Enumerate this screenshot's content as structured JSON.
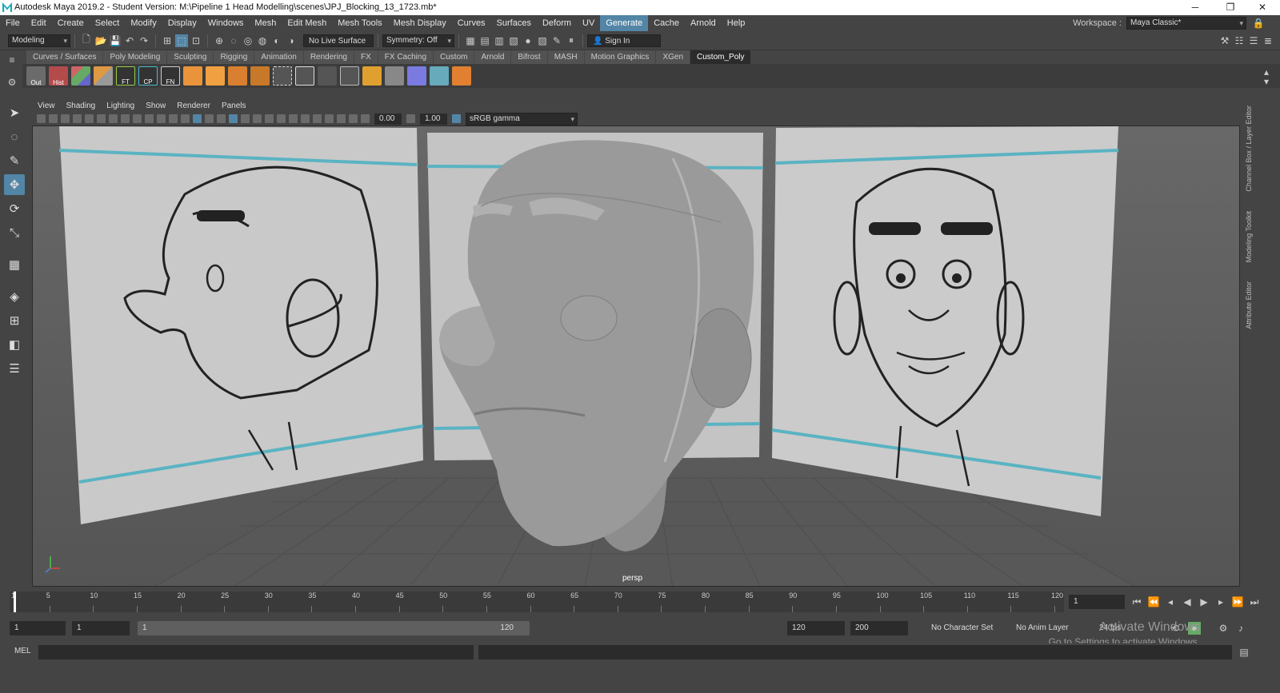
{
  "titlebar": {
    "title": "Autodesk Maya 2019.2 - Student Version: M:\\Pipeline 1 Head Modelling\\scenes\\JPJ_Blocking_13_1723.mb*",
    "minimize": "─",
    "restore": "❐",
    "close": "✕"
  },
  "menubar": {
    "items": [
      "File",
      "Edit",
      "Create",
      "Select",
      "Modify",
      "Display",
      "Windows",
      "Mesh",
      "Edit Mesh",
      "Mesh Tools",
      "Mesh Display",
      "Curves",
      "Surfaces",
      "Deform",
      "UV",
      "Generate",
      "Cache",
      "Arnold",
      "Help"
    ],
    "highlighted": "Generate",
    "workspace_label": "Workspace :",
    "workspace_value": "Maya Classic*"
  },
  "statusline": {
    "mode": "Modeling",
    "live_surface": "No Live Surface",
    "symmetry": "Symmetry: Off",
    "sign_in": "Sign In"
  },
  "shelf": {
    "tabs": [
      "Curves / Surfaces",
      "Poly Modeling",
      "Sculpting",
      "Rigging",
      "Animation",
      "Rendering",
      "FX",
      "FX Caching",
      "Custom",
      "Arnold",
      "Bifrost",
      "MASH",
      "Motion Graphics",
      "XGen",
      "Custom_Poly"
    ],
    "active_tab": "Custom_Poly",
    "labels": [
      "Out",
      "Hist",
      "",
      "",
      "FT",
      "CP",
      "FN"
    ]
  },
  "panel": {
    "menus": [
      "View",
      "Shading",
      "Lighting",
      "Show",
      "Renderer",
      "Panels"
    ],
    "exposure": "0.00",
    "gamma": "1.00",
    "colorspace": "sRGB gamma",
    "camera": "persp"
  },
  "side_tabs": [
    "Channel Box / Layer Editor",
    "Modeling Toolkit",
    "Attribute Editor"
  ],
  "timeline": {
    "ticks": [
      1,
      5,
      10,
      15,
      20,
      25,
      30,
      35,
      40,
      45,
      50,
      55,
      60,
      65,
      70,
      75,
      80,
      85,
      90,
      95,
      100,
      105,
      110,
      115,
      120
    ],
    "current_frame": "1"
  },
  "range": {
    "start": "1",
    "anim_start": "1",
    "range_start": "1",
    "range_end": "120",
    "end": "120",
    "anim_end": "200",
    "character_set": "No Character Set",
    "anim_layer": "No Anim Layer",
    "fps": "24 fps"
  },
  "cmdline": {
    "label": "MEL"
  },
  "watermark": {
    "line1": "Activate Windows",
    "line2": "Go to Settings to activate Windows."
  },
  "colors": {
    "accent": "#5285a6",
    "maya_logo": "#28a8c8"
  }
}
